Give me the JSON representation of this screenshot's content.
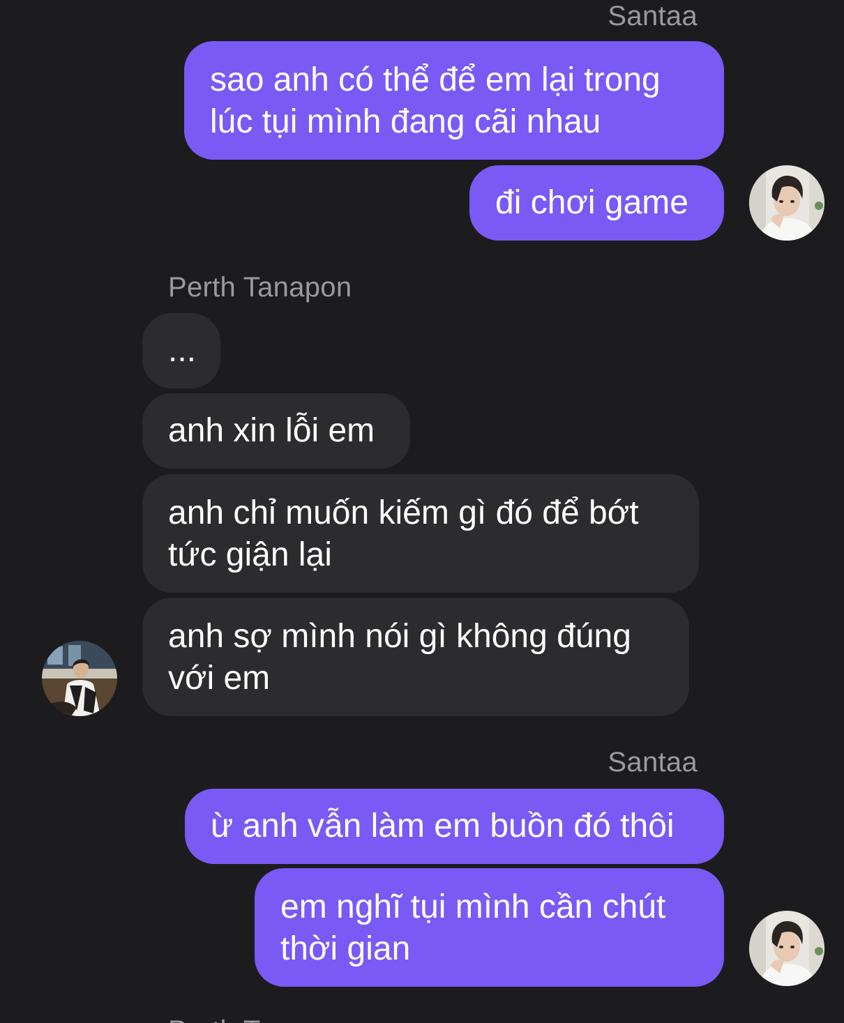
{
  "conversation": {
    "groups": [
      {
        "sender": "Santaa",
        "messages": [
          "sao anh có thể để em lại trong\nlúc tụi mình đang cãi nhau",
          "đi chơi game"
        ]
      },
      {
        "sender": "Perth Tanapon",
        "messages": [
          "...",
          "anh xin lỗi em",
          "anh chỉ muốn kiếm gì đó để bớt\ntức giận lại",
          "anh sợ mình nói gì không đúng\nvới em"
        ]
      },
      {
        "sender": "Santaa",
        "messages": [
          "ừ anh vẫn làm em buồn đó thôi",
          "em nghĩ tụi mình cần chút\nthời gian"
        ]
      },
      {
        "sender": "Perth Tanapon"
      }
    ]
  },
  "avatars": {
    "santaa": "avatar-santaa-photo",
    "perth": "avatar-perth-photo"
  },
  "colors": {
    "background": "#1c1c1e",
    "outgoing_bubble": "#7a5af5",
    "incoming_bubble": "#2c2c2e",
    "sender_name": "#9a9aa0",
    "message_text": "#ffffff"
  }
}
